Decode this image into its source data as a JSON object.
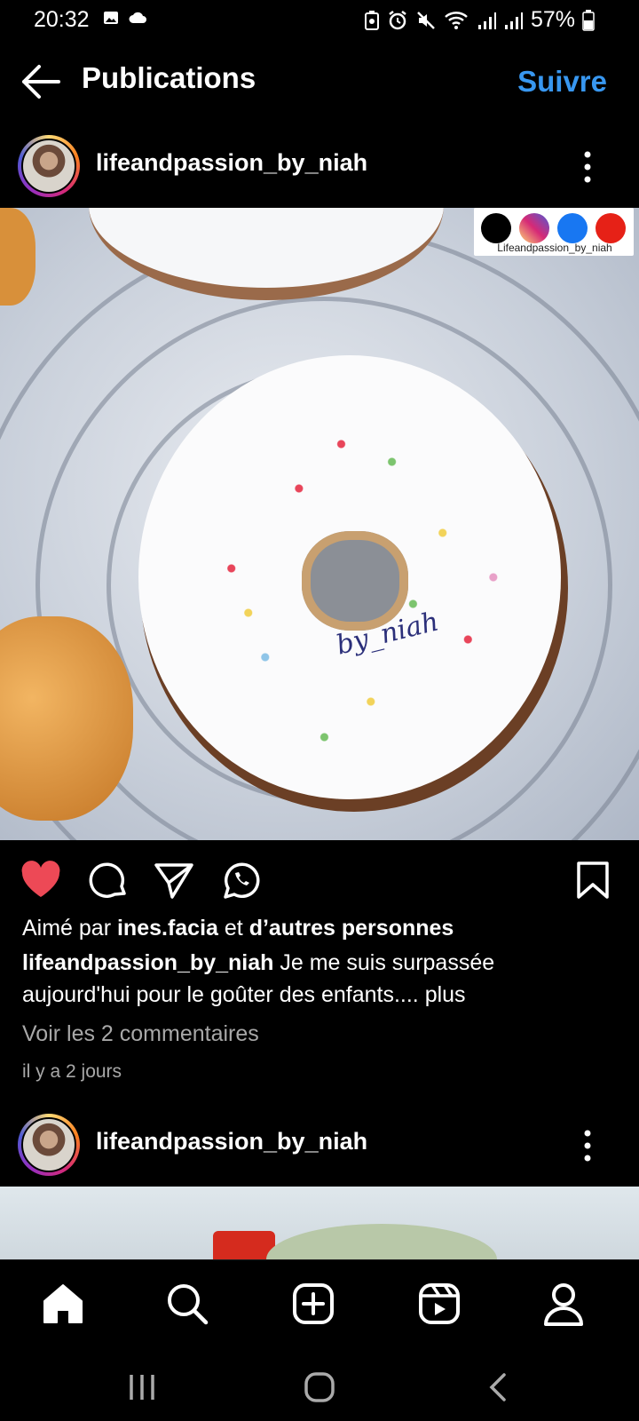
{
  "status_bar": {
    "time": "20:32",
    "battery": "57%"
  },
  "header": {
    "title": "Publications",
    "follow_label": "Suivre"
  },
  "post1": {
    "username": "lifeandpassion_by_niah",
    "image_badge_handle": "Lifeandpassion_by_niah",
    "image_watermark": "by_niah",
    "liked_prefix": "Aimé par ",
    "liked_user": "ines.facia",
    "liked_middle": " et ",
    "liked_others": "d’autres personnes",
    "caption_user": "lifeandpassion_by_niah",
    "caption_text": " Je me suis surpassée aujourd'hui pour le goûter des enfants....",
    "caption_more": " plus",
    "comments_link": "Voir les 2 commentaires",
    "time_ago": "il y a 2 jours",
    "liked": true
  },
  "post2": {
    "username": "lifeandpassion_by_niah"
  },
  "colors": {
    "accent": "#3897f0",
    "like": "#ed4956",
    "secondary_text": "#a8a8a8"
  },
  "icons": {
    "header": [
      "arrow-left-icon"
    ],
    "actions": [
      "heart-icon",
      "comment-icon",
      "share-icon",
      "whatsapp-icon",
      "bookmark-icon"
    ],
    "nav": [
      "home-icon",
      "search-icon",
      "add-post-icon",
      "reels-icon",
      "profile-icon"
    ],
    "system": [
      "recent-apps-icon",
      "home-circle-icon",
      "back-chevron-icon"
    ]
  }
}
